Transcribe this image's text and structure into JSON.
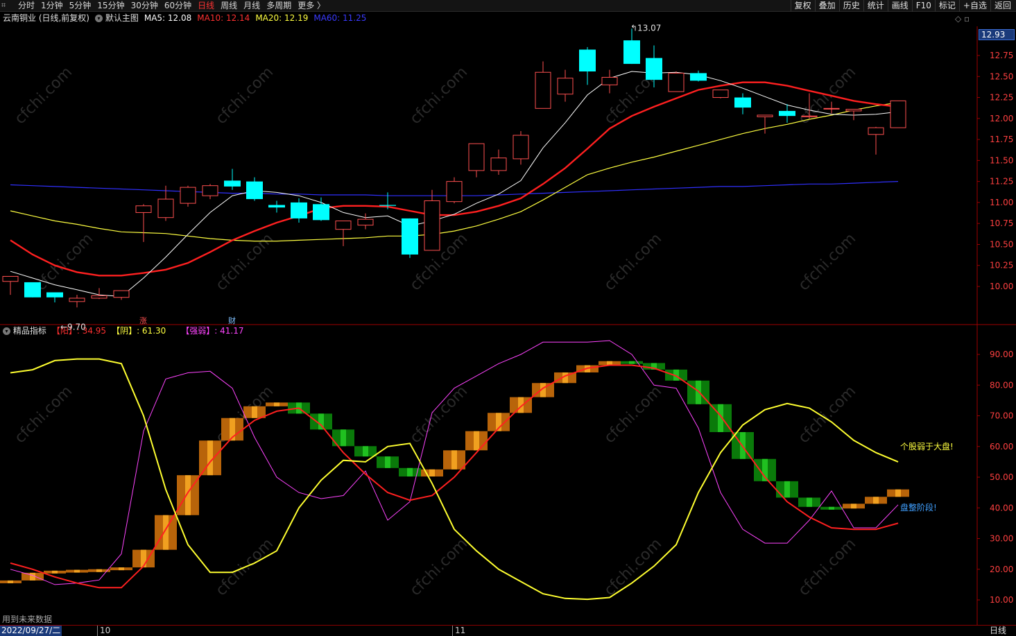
{
  "toolbar": {
    "periods": [
      "分时",
      "1分钟",
      "5分钟",
      "15分钟",
      "30分钟",
      "60分钟",
      "日线",
      "周线",
      "月线",
      "多周期",
      "更多 〉"
    ],
    "active_period": "日线",
    "tools": [
      "复权",
      "叠加",
      "历史",
      "统计",
      "画线",
      "F10",
      "标记",
      "+自选",
      "返回"
    ]
  },
  "main_chart": {
    "title": "云南铜业 (日线,前复权)",
    "indicator_name": "默认主图",
    "ma5": "MA5: 12.08",
    "ma10": "MA10: 12.14",
    "ma20": "MA20: 12.19",
    "ma60": "MA60: 11.25",
    "current_price": "12.93",
    "high_label": "13.07",
    "low_label": "9.70",
    "event_zhang": "涨",
    "event_cai": "财"
  },
  "sub_chart": {
    "title": "精品指标",
    "yang": "【阳】: 34.95",
    "yin": "【阴】: 61.30",
    "qiangruo": "【强弱】: 41.17",
    "note_weak": "个股弱于大盘!",
    "note_consolidate": "盘整阶段!",
    "future_note": "用到未来数据"
  },
  "time_axis": {
    "current_date": "2022/09/27/二",
    "month_labels": [
      "10",
      "11"
    ],
    "period_status": "日线"
  },
  "colors": {
    "up": "#ff5050",
    "down": "#00ffff",
    "ma5": "#ffffff",
    "ma10": "#ff2020",
    "ma20": "#ffff40",
    "ma60": "#3030ff",
    "grid": "#7a0000",
    "axis_text": "#ff4040",
    "magenta": "#ff44ff"
  },
  "chart_data": [
    {
      "type": "candlestick",
      "title": "云南铜业 (日线,前复权)",
      "ylim": [
        9.7,
        13.07
      ],
      "y_ticks": [
        10.0,
        10.25,
        10.5,
        10.75,
        11.0,
        11.25,
        11.5,
        11.75,
        12.0,
        12.25,
        12.5,
        12.75
      ],
      "candles": [
        {
          "o": 10.06,
          "h": 10.12,
          "l": 9.9,
          "c": 10.12
        },
        {
          "o": 10.05,
          "h": 10.05,
          "l": 9.87,
          "c": 9.87
        },
        {
          "o": 9.93,
          "h": 9.93,
          "l": 9.81,
          "c": 9.87
        },
        {
          "o": 9.82,
          "h": 9.9,
          "l": 9.75,
          "c": 9.86
        },
        {
          "o": 9.86,
          "h": 9.98,
          "l": 9.85,
          "c": 9.89
        },
        {
          "o": 9.87,
          "h": 9.95,
          "l": 9.84,
          "c": 9.95
        },
        {
          "o": 10.88,
          "h": 10.98,
          "l": 10.53,
          "c": 10.96
        },
        {
          "o": 10.82,
          "h": 11.2,
          "l": 10.78,
          "c": 11.04
        },
        {
          "o": 10.99,
          "h": 11.2,
          "l": 10.95,
          "c": 11.18
        },
        {
          "o": 11.08,
          "h": 11.22,
          "l": 11.04,
          "c": 11.2
        },
        {
          "o": 11.26,
          "h": 11.4,
          "l": 11.15,
          "c": 11.19
        },
        {
          "o": 11.25,
          "h": 11.3,
          "l": 11.02,
          "c": 11.04
        },
        {
          "o": 10.97,
          "h": 11.02,
          "l": 10.88,
          "c": 10.94
        },
        {
          "o": 11.0,
          "h": 11.05,
          "l": 10.76,
          "c": 10.81
        },
        {
          "o": 10.98,
          "h": 11.06,
          "l": 10.78,
          "c": 10.79
        },
        {
          "o": 10.68,
          "h": 10.78,
          "l": 10.48,
          "c": 10.78
        },
        {
          "o": 10.73,
          "h": 10.87,
          "l": 10.68,
          "c": 10.8
        },
        {
          "o": 10.97,
          "h": 11.12,
          "l": 10.92,
          "c": 10.96
        },
        {
          "o": 10.81,
          "h": 10.81,
          "l": 10.34,
          "c": 10.38
        },
        {
          "o": 10.43,
          "h": 11.15,
          "l": 10.43,
          "c": 11.02
        },
        {
          "o": 11.01,
          "h": 11.3,
          "l": 10.99,
          "c": 11.25
        },
        {
          "o": 11.38,
          "h": 11.62,
          "l": 11.3,
          "c": 11.7
        },
        {
          "o": 11.38,
          "h": 11.63,
          "l": 11.33,
          "c": 11.53
        },
        {
          "o": 11.52,
          "h": 11.85,
          "l": 11.45,
          "c": 11.8
        },
        {
          "o": 12.12,
          "h": 12.68,
          "l": 12.12,
          "c": 12.55
        },
        {
          "o": 12.29,
          "h": 12.58,
          "l": 12.2,
          "c": 12.48
        },
        {
          "o": 12.82,
          "h": 12.85,
          "l": 12.4,
          "c": 12.56
        },
        {
          "o": 12.4,
          "h": 12.58,
          "l": 12.3,
          "c": 12.49
        },
        {
          "o": 12.93,
          "h": 13.07,
          "l": 12.65,
          "c": 12.65
        },
        {
          "o": 12.72,
          "h": 12.87,
          "l": 12.37,
          "c": 12.46
        },
        {
          "o": 12.32,
          "h": 12.56,
          "l": 12.32,
          "c": 12.54
        },
        {
          "o": 12.54,
          "h": 12.57,
          "l": 12.44,
          "c": 12.45
        },
        {
          "o": 12.25,
          "h": 12.34,
          "l": 12.24,
          "c": 12.34
        },
        {
          "o": 12.25,
          "h": 12.3,
          "l": 12.05,
          "c": 12.13
        },
        {
          "o": 12.02,
          "h": 12.04,
          "l": 11.82,
          "c": 12.04
        },
        {
          "o": 12.09,
          "h": 12.17,
          "l": 11.95,
          "c": 12.03
        },
        {
          "o": 12.02,
          "h": 12.3,
          "l": 12.0,
          "c": 12.03
        },
        {
          "o": 12.12,
          "h": 12.2,
          "l": 12.06,
          "c": 12.12
        },
        {
          "o": 12.09,
          "h": 12.11,
          "l": 11.98,
          "c": 12.11
        },
        {
          "o": 11.81,
          "h": 11.9,
          "l": 11.57,
          "c": 11.89
        },
        {
          "o": 11.89,
          "h": 12.21,
          "l": 11.89,
          "c": 12.21
        }
      ],
      "ma5": [
        10.18,
        10.1,
        10.02,
        9.96,
        9.9,
        9.88,
        10.1,
        10.35,
        10.62,
        10.88,
        11.08,
        11.14,
        11.12,
        11.08,
        11.0,
        10.88,
        10.82,
        10.84,
        10.72,
        10.78,
        10.86,
        10.99,
        11.1,
        11.26,
        11.65,
        11.95,
        12.28,
        12.48,
        12.56,
        12.54,
        12.55,
        12.52,
        12.45,
        12.36,
        12.26,
        12.16,
        12.1,
        12.05,
        12.04,
        12.05,
        12.08
      ],
      "ma10": [
        10.55,
        10.38,
        10.25,
        10.17,
        10.13,
        10.13,
        10.16,
        10.2,
        10.28,
        10.41,
        10.55,
        10.66,
        10.76,
        10.84,
        10.93,
        10.96,
        10.96,
        10.95,
        10.9,
        10.85,
        10.85,
        10.89,
        10.96,
        11.05,
        11.22,
        11.41,
        11.64,
        11.88,
        12.03,
        12.14,
        12.24,
        12.34,
        12.39,
        12.43,
        12.43,
        12.39,
        12.33,
        12.27,
        12.21,
        12.17,
        12.14
      ],
      "ma20": [
        10.9,
        10.84,
        10.78,
        10.74,
        10.69,
        10.65,
        10.64,
        10.63,
        10.6,
        10.57,
        10.55,
        10.54,
        10.54,
        10.55,
        10.56,
        10.57,
        10.58,
        10.6,
        10.6,
        10.62,
        10.66,
        10.72,
        10.8,
        10.89,
        11.03,
        11.18,
        11.33,
        11.41,
        11.48,
        11.54,
        11.61,
        11.68,
        11.75,
        11.82,
        11.88,
        11.93,
        11.99,
        12.04,
        12.1,
        12.15,
        12.19
      ],
      "ma60": [
        11.21,
        11.2,
        11.19,
        11.18,
        11.17,
        11.16,
        11.15,
        11.14,
        11.13,
        11.12,
        11.11,
        11.11,
        11.1,
        11.1,
        11.09,
        11.09,
        11.09,
        11.08,
        11.08,
        11.08,
        11.08,
        11.08,
        11.09,
        11.1,
        11.11,
        11.12,
        11.13,
        11.14,
        11.15,
        11.16,
        11.17,
        11.18,
        11.19,
        11.19,
        11.2,
        11.21,
        11.22,
        11.22,
        11.23,
        11.24,
        11.25
      ]
    },
    {
      "type": "line",
      "title": "精品指标",
      "ylim": [
        0,
        100
      ],
      "y_ticks": [
        10,
        20,
        30,
        40,
        50,
        60,
        70,
        80,
        90
      ],
      "series": [
        {
          "name": "阳",
          "color": "#ff2020",
          "values": [
            22,
            20,
            17.5,
            15.5,
            14,
            14,
            21,
            33,
            45,
            55,
            63,
            68.5,
            71.5,
            72.5,
            67,
            58,
            51,
            45,
            42.5,
            44,
            50,
            58,
            66,
            73,
            79,
            83,
            85.5,
            86.5,
            86.5,
            85.5,
            83,
            78,
            70,
            60,
            50,
            42,
            37,
            33.5,
            33,
            33,
            35
          ]
        },
        {
          "name": "阴",
          "color": "#ffff30",
          "values": [
            84,
            85,
            88,
            88.5,
            88.5,
            87,
            70,
            46,
            28,
            19,
            19,
            22,
            26,
            40,
            49,
            55.5,
            55,
            60,
            61,
            48,
            33,
            26,
            20,
            16,
            12,
            10.5,
            10.2,
            10.8,
            15.5,
            21,
            28,
            45,
            58,
            67,
            72,
            74,
            72.5,
            68,
            62,
            58,
            55
          ]
        },
        {
          "name": "强弱",
          "color": "#ff44ff",
          "values": [
            20,
            18,
            15,
            15.5,
            16.5,
            25,
            65,
            82,
            84,
            84.5,
            79,
            63,
            50,
            45,
            43,
            44,
            52,
            36,
            42,
            71,
            79,
            83,
            87,
            90,
            94,
            94,
            94,
            94.5,
            90,
            80,
            79,
            66,
            45,
            33,
            28.5,
            28.5,
            36,
            45.5,
            33.5,
            33.5,
            41
          ]
        }
      ],
      "annotations": [
        "个股弱于大盘!",
        "盘整阶段!"
      ]
    }
  ]
}
